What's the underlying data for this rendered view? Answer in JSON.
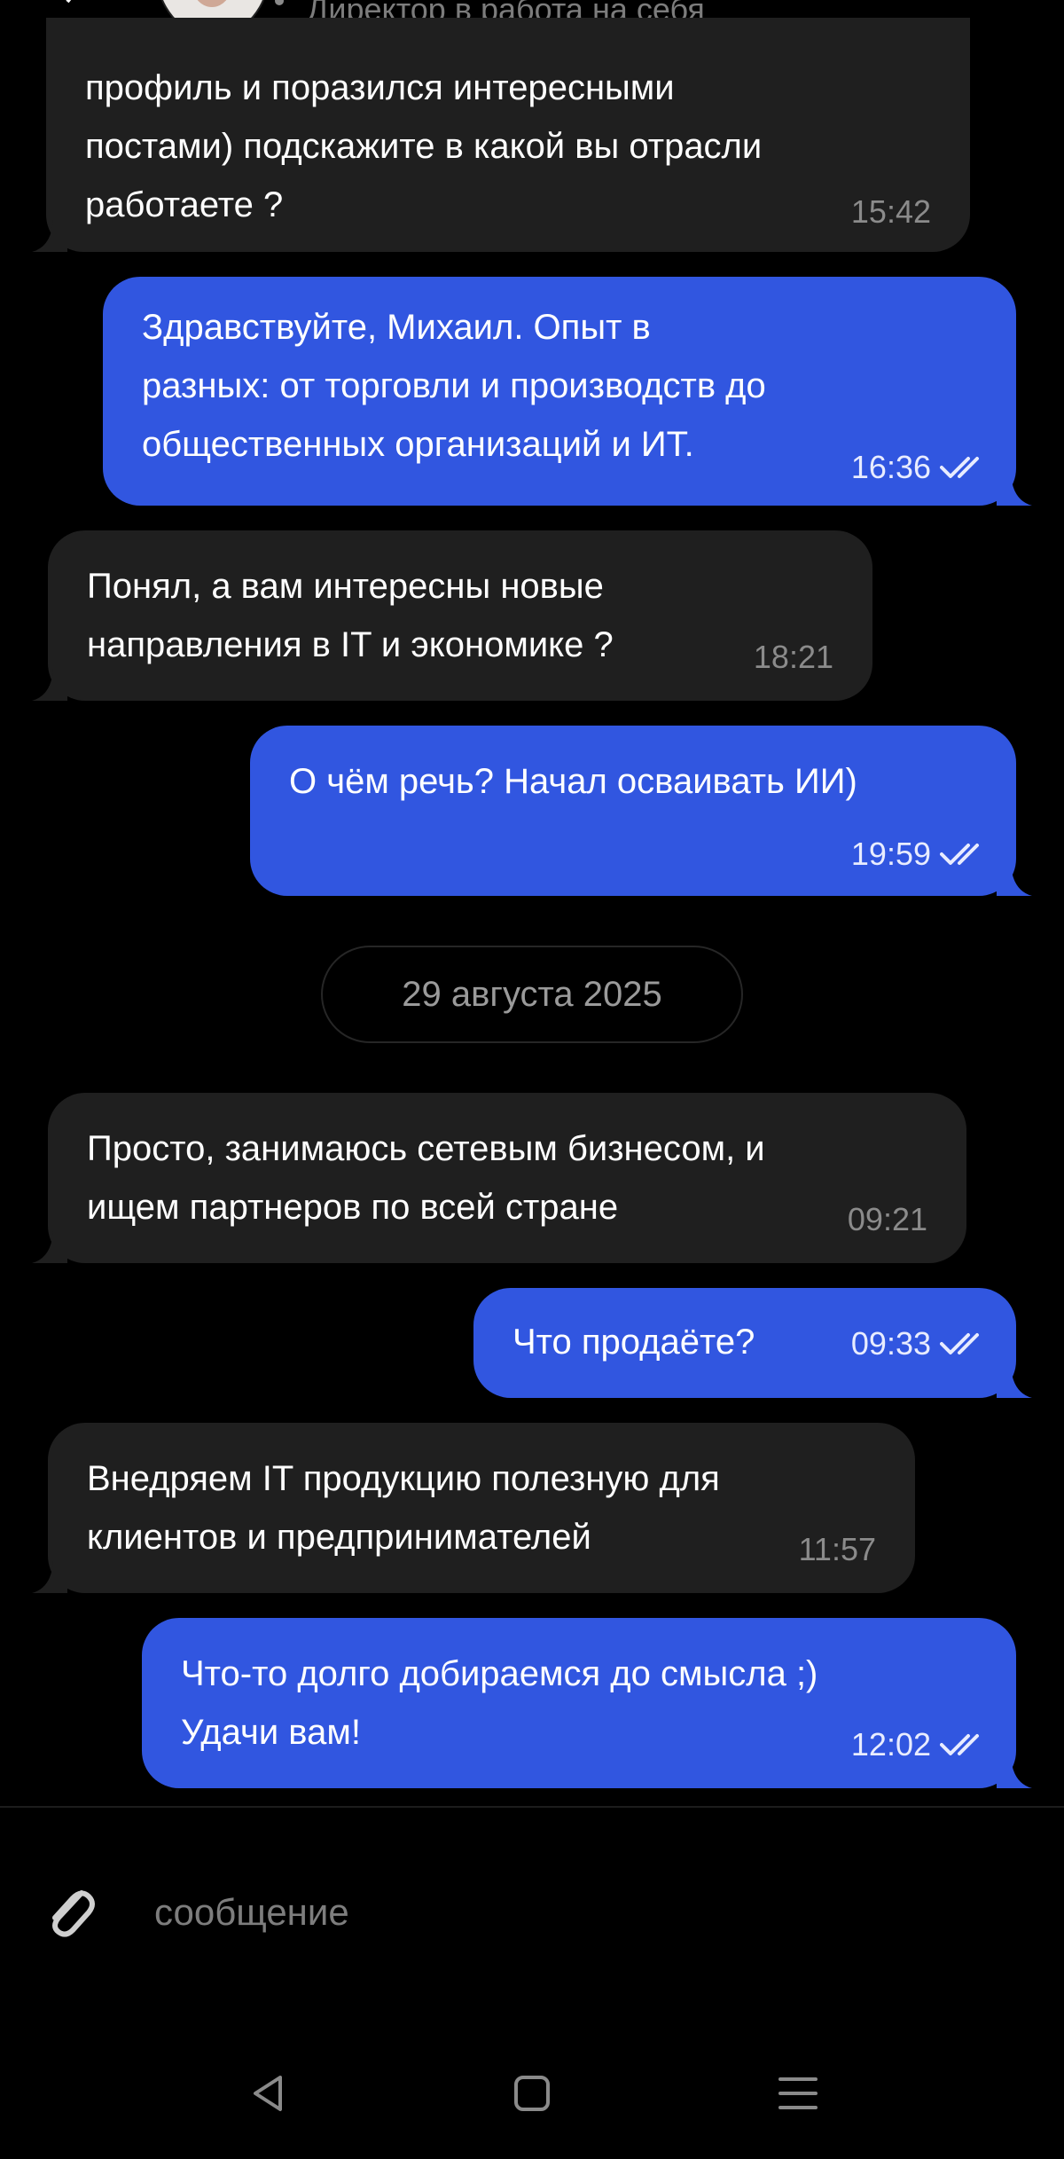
{
  "header": {
    "subtitle": "Директор в работа на себя"
  },
  "messages": [
    {
      "dir": "in",
      "lines": [
        "профиль и поразился интересными",
        "постами) подскажите в какой вы отрасли",
        "работаете ?"
      ],
      "time": "15:42"
    },
    {
      "dir": "out",
      "lines": [
        "Здравствуйте, Михаил. Опыт в",
        "разных: от торговли и производств до",
        "общественных организаций и ИТ."
      ],
      "time": "16:36",
      "status": "read"
    },
    {
      "dir": "in",
      "lines": [
        "Понял, а вам интересны новые",
        "направления в IT и экономике ?"
      ],
      "time": "18:21"
    },
    {
      "dir": "out",
      "lines": [
        "О чём речь? Начал осваивать ИИ)"
      ],
      "time": "19:59",
      "status": "read"
    },
    {
      "dir": "in",
      "lines": [
        "Просто, занимаюсь сетевым бизнесом, и",
        "ищем партнеров по всей стране"
      ],
      "time": "09:21"
    },
    {
      "dir": "out",
      "lines": [
        "Что продаёте?"
      ],
      "time": "09:33",
      "status": "read"
    },
    {
      "dir": "in",
      "lines": [
        "Внедряем IT продукцию полезную для",
        "клиентов и предпринимателей"
      ],
      "time": "11:57"
    },
    {
      "dir": "out",
      "lines": [
        "Что-то долго добираемся до смысла ;)",
        "Удачи вам!"
      ],
      "time": "12:02",
      "status": "read"
    }
  ],
  "date_separator": "29 августа 2025",
  "composer": {
    "placeholder": "сообщение",
    "attach_icon": "paperclip-icon"
  },
  "nav": {
    "back_icon": "triangle-back-icon",
    "home_icon": "square-home-icon",
    "menu_icon": "three-lines-menu-icon"
  },
  "colors": {
    "background": "#000000",
    "incoming_bubble": "#1f1f1f",
    "outgoing_bubble": "#3156e0",
    "muted_text": "#8b8b8b"
  }
}
